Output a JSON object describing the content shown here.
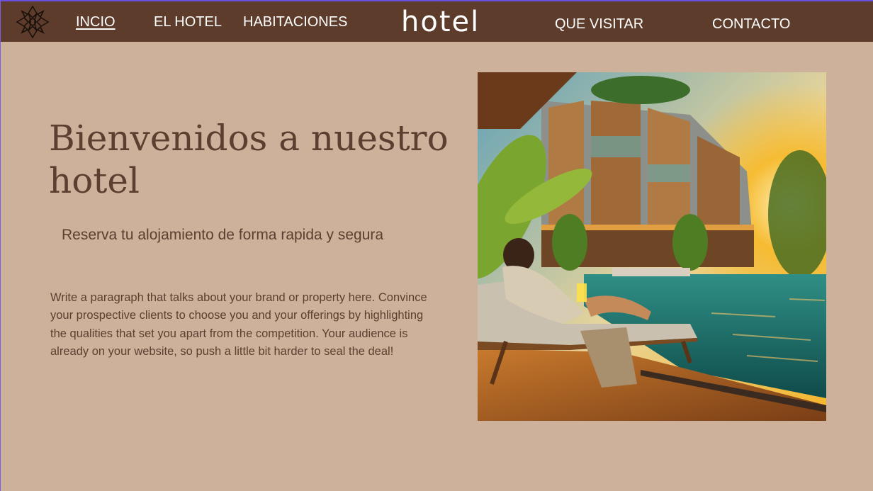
{
  "nav": {
    "links": [
      {
        "label": "INCIO",
        "active": true
      },
      {
        "label": "EL HOTEL"
      },
      {
        "label": "HABITACIONES"
      },
      {
        "label": "QUE VISITAR"
      },
      {
        "label": "CONTACTO"
      }
    ],
    "brand": "hotel",
    "logo_icon": "ornament-icon"
  },
  "hero": {
    "title": "Bienvenidos a nuestro hotel",
    "subtitle": "Reserva tu alojamiento de forma rapida y segura",
    "paragraph": "Write a paragraph that talks about your brand or property here. Convince your prospective clients to choose you and your offerings by highlighting the qualities that set you apart from the competition. Your audience is already on your website, so push a little bit harder to seal the deal!"
  },
  "colors": {
    "nav_bg": "#5e3c2b",
    "page_bg": "#cdb19a",
    "text": "#5b3f30"
  }
}
